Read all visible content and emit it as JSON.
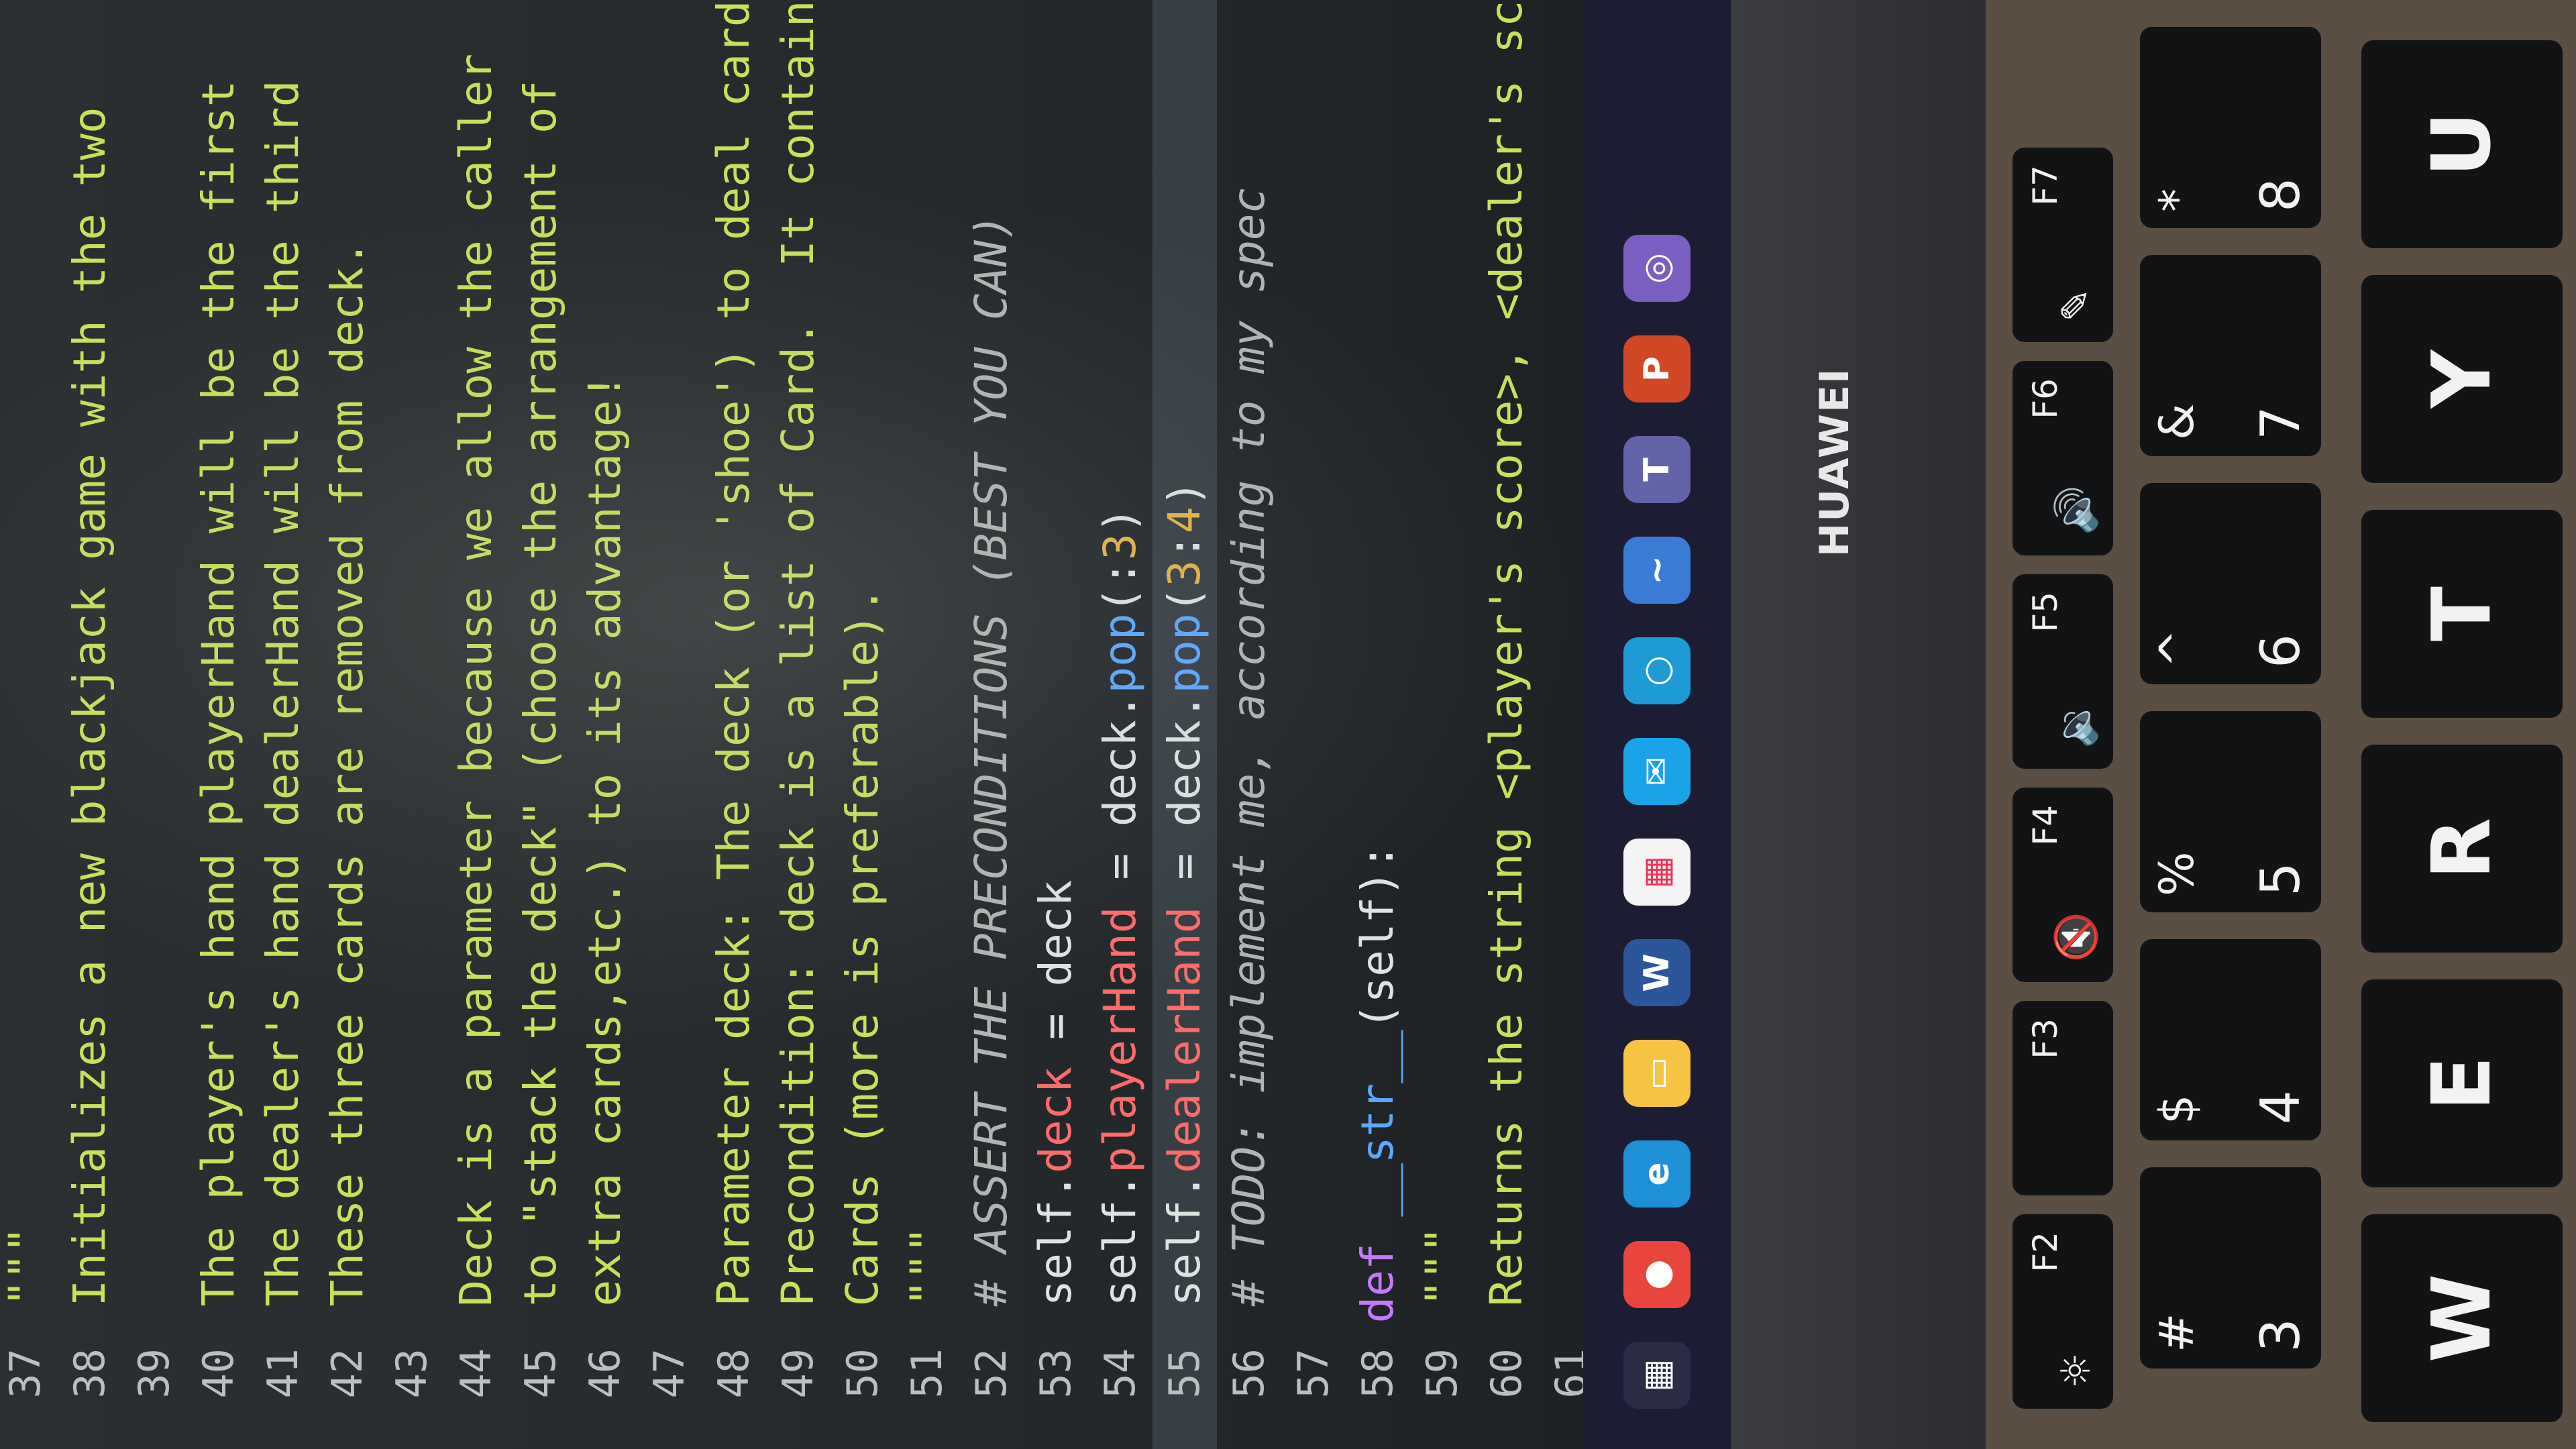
{
  "editor": {
    "lines": [
      {
        "n": "37",
        "segs": [
          {
            "t": "\"\"\"",
            "c": "doc"
          }
        ]
      },
      {
        "n": "38",
        "segs": [
          {
            "t": "Initializes a new blackjack game with the two",
            "c": "doc"
          }
        ]
      },
      {
        "n": "39",
        "segs": [
          {
            "t": "",
            "c": "doc"
          }
        ]
      },
      {
        "n": "40",
        "segs": [
          {
            "t": "The player's hand playerHand will be the first",
            "c": "doc"
          }
        ]
      },
      {
        "n": "41",
        "segs": [
          {
            "t": "The dealer's hand dealerHand will be the third",
            "c": "doc"
          }
        ]
      },
      {
        "n": "42",
        "segs": [
          {
            "t": "These three cards are removed from deck.",
            "c": "doc"
          }
        ]
      },
      {
        "n": "43",
        "segs": [
          {
            "t": "",
            "c": "doc"
          }
        ]
      },
      {
        "n": "44",
        "segs": [
          {
            "t": "Deck is a parameter because we allow the caller",
            "c": "doc"
          }
        ]
      },
      {
        "n": "45",
        "segs": [
          {
            "t": "to \"stack the deck\" (choose the arrangement of",
            "c": "doc"
          }
        ]
      },
      {
        "n": "46",
        "segs": [
          {
            "t": "extra cards,etc.) to its advantage!",
            "c": "doc"
          }
        ]
      },
      {
        "n": "47",
        "segs": [
          {
            "t": "",
            "c": "doc"
          }
        ]
      },
      {
        "n": "48",
        "segs": [
          {
            "t": "Parameter deck: The deck (or 'shoe') to deal card",
            "c": "doc"
          }
        ]
      },
      {
        "n": "49",
        "segs": [
          {
            "t": "Precondition: deck is a list of Card.  It contain",
            "c": "doc"
          }
        ]
      },
      {
        "n": "50",
        "segs": [
          {
            "t": "Cards (more is preferable).",
            "c": "doc"
          }
        ]
      },
      {
        "n": "51",
        "segs": [
          {
            "t": "\"\"\"",
            "c": "doc"
          }
        ]
      },
      {
        "n": "52",
        "segs": [
          {
            "t": "# ASSERT THE PRECONDITIONS (BEST YOU CAN)",
            "c": "cmt"
          }
        ]
      },
      {
        "n": "53",
        "segs": [
          {
            "t": "self.",
            "c": "self"
          },
          {
            "t": "deck",
            "c": "attr"
          },
          {
            "t": " = deck",
            "c": "plain"
          }
        ]
      },
      {
        "n": "54",
        "segs": [
          {
            "t": "self.",
            "c": "self"
          },
          {
            "t": "playerHand",
            "c": "attr"
          },
          {
            "t": " = deck.",
            "c": "plain"
          },
          {
            "t": "pop",
            "c": "fn"
          },
          {
            "t": "(:",
            "c": "plain"
          },
          {
            "t": "3",
            "c": "num"
          },
          {
            "t": ")",
            "c": "plain"
          }
        ]
      },
      {
        "n": "55",
        "segs": [
          {
            "t": "self.",
            "c": "self"
          },
          {
            "t": "dealerHand",
            "c": "attr"
          },
          {
            "t": " = deck.",
            "c": "plain"
          },
          {
            "t": "pop",
            "c": "fn"
          },
          {
            "t": "(",
            "c": "plain"
          },
          {
            "t": "3",
            "c": "num"
          },
          {
            "t": ":",
            "c": "plain"
          },
          {
            "t": "4",
            "c": "num"
          },
          {
            "t": ")",
            "c": "plain"
          }
        ]
      },
      {
        "n": "56",
        "segs": [
          {
            "t": "# TODO: implement me, according to my spec",
            "c": "cmt"
          }
        ]
      },
      {
        "n": "57",
        "segs": [
          {
            "t": "",
            "c": "plain"
          }
        ]
      },
      {
        "n": "58",
        "segs": [
          {
            "t": "def ",
            "c": "kw"
          },
          {
            "t": "__str__",
            "c": "fn"
          },
          {
            "t": "(self):",
            "c": "plain"
          }
        ]
      },
      {
        "n": "59",
        "segs": [
          {
            "t": "\"\"\"",
            "c": "doc"
          }
        ]
      },
      {
        "n": "60",
        "segs": [
          {
            "t": "Returns the string <player's score>, <dealer's score>",
            "c": "doc"
          }
        ]
      },
      {
        "n": "61",
        "segs": [
          {
            "t": "",
            "c": "doc"
          }
        ]
      }
    ]
  },
  "taskbar": {
    "icons": [
      "grid-icon",
      "chrome-icon",
      "edge-icon",
      "file-explorer-icon",
      "word-icon",
      "store-icon",
      "mail-icon",
      "cortana-icon",
      "python-icon",
      "teams-icon",
      "powerpoint-icon",
      "app-icon"
    ]
  },
  "bezel": {
    "brand": "HUAWEI"
  },
  "keyboard": {
    "fkeys": [
      {
        "label": "F2",
        "icon": "☼"
      },
      {
        "label": "F3",
        "icon": ""
      },
      {
        "label": "F4",
        "icon": "🔇"
      },
      {
        "label": "F5",
        "icon": "🔉"
      },
      {
        "label": "F6",
        "icon": "🔊"
      },
      {
        "label": "F7",
        "icon": "✎"
      }
    ],
    "numrow": [
      {
        "top": "#",
        "bot": "3"
      },
      {
        "top": "$",
        "bot": "4"
      },
      {
        "top": "%",
        "bot": "5"
      },
      {
        "top": "^",
        "bot": "6"
      },
      {
        "top": "&",
        "bot": "7"
      },
      {
        "top": "*",
        "bot": "8"
      }
    ],
    "letters": [
      "W",
      "E",
      "R",
      "T",
      "Y",
      "U"
    ]
  },
  "colors": {
    "docstring": "#c8e05a",
    "keyword": "#c678ff",
    "attribute": "#ff6b6b",
    "function": "#5aa8ff",
    "number": "#e6b24a"
  }
}
